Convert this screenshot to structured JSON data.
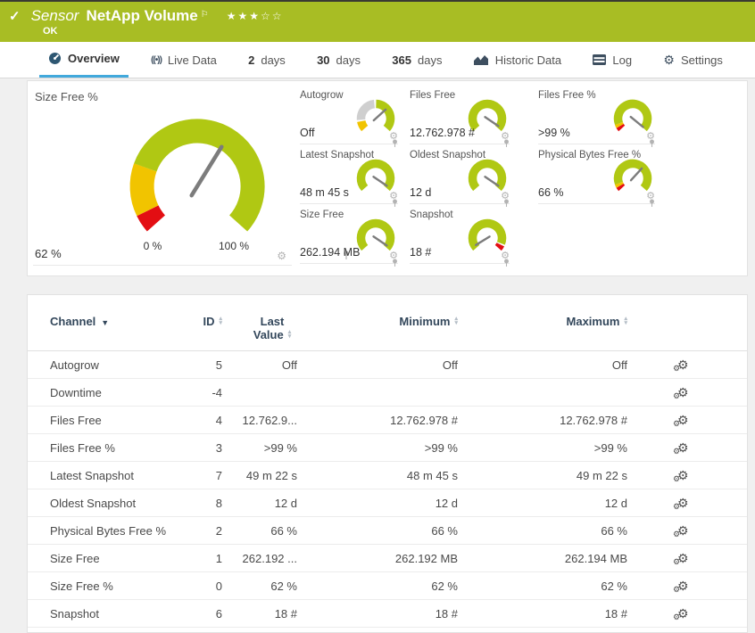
{
  "header": {
    "check_icon": "✓",
    "kind": "Sensor",
    "title": "NetApp Volume",
    "flag_icon": "⚐",
    "stars": "★★★☆☆",
    "status": "OK"
  },
  "tabs": [
    {
      "label": "Overview",
      "icon": "gauge-icon",
      "active": true
    },
    {
      "label": "Live Data",
      "icon": "live-icon"
    },
    {
      "num": "2",
      "label": "days"
    },
    {
      "num": "30",
      "label": "days"
    },
    {
      "num": "365",
      "label": "days"
    },
    {
      "label": "Historic Data",
      "icon": "chart-icon"
    },
    {
      "label": "Log",
      "icon": "log-icon"
    },
    {
      "label": "Settings",
      "icon": "gear-icon"
    }
  ],
  "gauges": {
    "main": {
      "label": "Size Free %",
      "value": "62 %",
      "scale_min": "0 %",
      "scale_max": "100 %",
      "needle": 0.62,
      "segments": [
        {
          "color": "gauge_red",
          "from": 0,
          "to": 0.06
        },
        {
          "color": "gauge_yellow",
          "from": 0.06,
          "to": 0.235
        },
        {
          "color": "gauge_green",
          "from": 0.235,
          "to": 1
        }
      ]
    },
    "small": [
      {
        "label": "Autogrow",
        "value": "Off",
        "needle": 0.68,
        "segments": [
          {
            "color": "gauge_yellow",
            "from": 0,
            "to": 0.12
          },
          {
            "color": "gauge_gray",
            "from": 0.14,
            "to": 0.48
          },
          {
            "color": "gauge_green",
            "from": 0.505,
            "to": 1
          }
        ]
      },
      {
        "label": "Files Free",
        "value": "12.762.978 #",
        "needle": 0.97,
        "segments": [
          {
            "color": "gauge_green",
            "from": 0,
            "to": 1
          }
        ]
      },
      {
        "label": "Files Free %",
        "value": ">99 %",
        "needle": 0.99,
        "segments": [
          {
            "color": "gauge_red",
            "from": 0,
            "to": 0.045
          },
          {
            "color": "gauge_yellow",
            "from": 0.045,
            "to": 0.085
          },
          {
            "color": "gauge_green",
            "from": 0.085,
            "to": 1
          }
        ]
      },
      {
        "label": "Latest Snapshot",
        "value": "48 m 45 s",
        "needle": 0.97,
        "segments": [
          {
            "color": "gauge_green",
            "from": 0,
            "to": 1
          }
        ]
      },
      {
        "label": "Oldest Snapshot",
        "value": "12 d",
        "needle": 0.97,
        "segments": [
          {
            "color": "gauge_green",
            "from": 0,
            "to": 1
          }
        ]
      },
      {
        "label": "Physical Bytes Free %",
        "value": "66 %",
        "needle": 0.66,
        "segments": [
          {
            "color": "gauge_red",
            "from": 0,
            "to": 0.045
          },
          {
            "color": "gauge_yellow",
            "from": 0.045,
            "to": 0.085
          },
          {
            "color": "gauge_green",
            "from": 0.085,
            "to": 1
          }
        ]
      },
      {
        "label": "Size Free",
        "value": "262.194 MB",
        "needle": 0.97,
        "segments": [
          {
            "color": "gauge_green",
            "from": 0,
            "to": 1
          }
        ]
      },
      {
        "label": "Snapshot",
        "value": "18 #",
        "needle": 0.04,
        "segments": [
          {
            "color": "gauge_green",
            "from": 0,
            "to": 0.92
          },
          {
            "color": "gauge_red",
            "from": 0.94,
            "to": 1
          }
        ]
      }
    ]
  },
  "table": {
    "columns": [
      {
        "label": "Channel",
        "sort": "desc"
      },
      {
        "label": "ID",
        "sort": "both"
      },
      {
        "label": "Last Value",
        "line1": "Last",
        "line2": "Value",
        "sort": "both"
      },
      {
        "label": "Minimum",
        "sort": "both"
      },
      {
        "label": "Maximum",
        "sort": "both"
      }
    ],
    "rows": [
      {
        "channel": "Autogrow",
        "id": "5",
        "last": "Off",
        "min": "Off",
        "max": "Off"
      },
      {
        "channel": "Downtime",
        "id": "-4",
        "last": "",
        "min": "",
        "max": ""
      },
      {
        "channel": "Files Free",
        "id": "4",
        "last": "12.762.9...",
        "min": "12.762.978 #",
        "max": "12.762.978 #"
      },
      {
        "channel": "Files Free %",
        "id": "3",
        "last": ">99 %",
        "min": ">99 %",
        "max": ">99 %"
      },
      {
        "channel": "Latest Snapshot",
        "id": "7",
        "last": "49 m 22 s",
        "min": "48 m 45 s",
        "max": "49 m 22 s"
      },
      {
        "channel": "Oldest Snapshot",
        "id": "8",
        "last": "12 d",
        "min": "12 d",
        "max": "12 d"
      },
      {
        "channel": "Physical Bytes Free %",
        "id": "2",
        "last": "66 %",
        "min": "66 %",
        "max": "66 %"
      },
      {
        "channel": "Size Free",
        "id": "1",
        "last": "262.192 ...",
        "min": "262.192 MB",
        "max": "262.194 MB"
      },
      {
        "channel": "Size Free %",
        "id": "0",
        "last": "62 %",
        "min": "62 %",
        "max": "62 %"
      },
      {
        "channel": "Snapshot",
        "id": "6",
        "last": "18 #",
        "min": "18 #",
        "max": "18 #"
      }
    ]
  },
  "colors": {
    "header_bg": "#a8bd24",
    "tab_accent": "#41a9dc",
    "gauge_green": "#b0c813",
    "gauge_yellow": "#f1c400",
    "gauge_red": "#e30e13",
    "gauge_gray": "#cfcfcf",
    "needle": "#7c7c7c",
    "table_header_text": "#33475b"
  }
}
